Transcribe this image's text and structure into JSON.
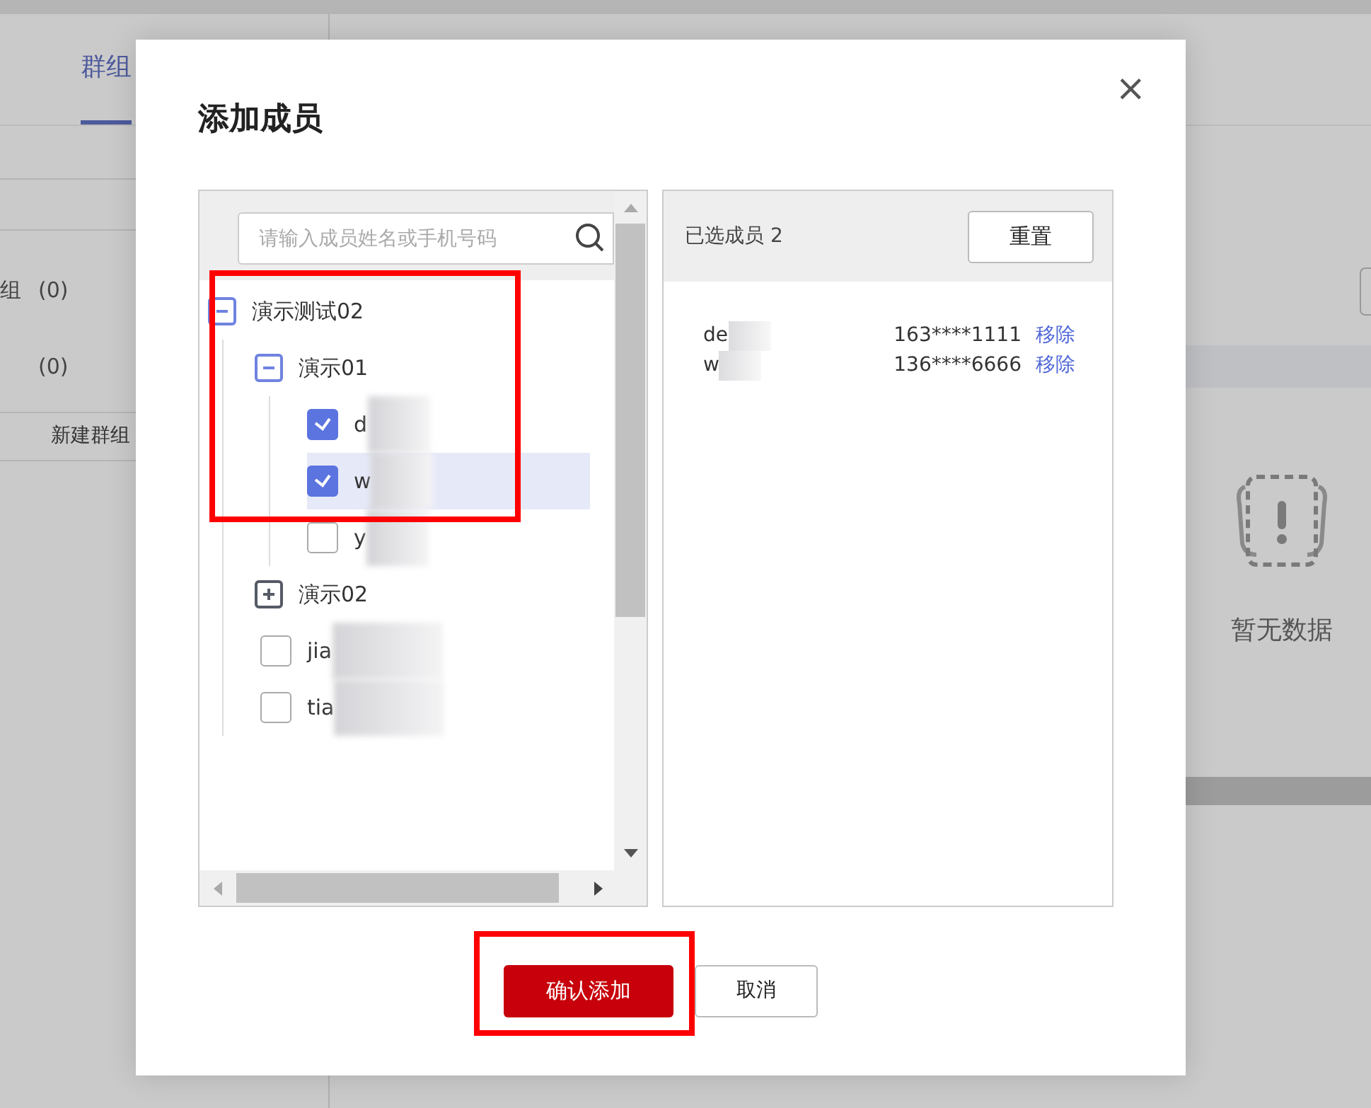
{
  "background": {
    "tabs": [
      {
        "label": "群组",
        "selected": true
      }
    ],
    "groups": [
      {
        "name": "组",
        "count": "(0)"
      },
      {
        "count": "(0)"
      }
    ],
    "new_group_button": "新建群组",
    "empty_text": "暂无数据"
  },
  "dialog": {
    "title": "添加成员",
    "close": "×",
    "search": {
      "placeholder": "请输入成员姓名或手机号码"
    },
    "tree": [
      {
        "kind": "group",
        "label": "演示测试02",
        "expanded": true,
        "children": [
          {
            "kind": "group",
            "label": "演示01",
            "expanded": true,
            "children": [
              {
                "kind": "member",
                "label": "d",
                "checked": true,
                "selected": false
              },
              {
                "kind": "member",
                "label": "w",
                "checked": true,
                "selected": true
              },
              {
                "kind": "member",
                "label": "y",
                "checked": false,
                "selected": false
              }
            ]
          },
          {
            "kind": "group",
            "label": "演示02",
            "expanded": false
          },
          {
            "kind": "member",
            "label": "jia",
            "checked": false,
            "selected": false
          },
          {
            "kind": "member",
            "label": "tia",
            "checked": false,
            "selected": false
          }
        ]
      }
    ],
    "selected_panel": {
      "title": "已选成员 2",
      "reset_button": "重置",
      "members": [
        {
          "name": "de",
          "phone": "163****1111",
          "remove": "移除"
        },
        {
          "name": "w",
          "phone": "136****6666",
          "remove": "移除"
        }
      ]
    },
    "buttons": {
      "confirm": "确认添加",
      "cancel": "取消"
    }
  }
}
